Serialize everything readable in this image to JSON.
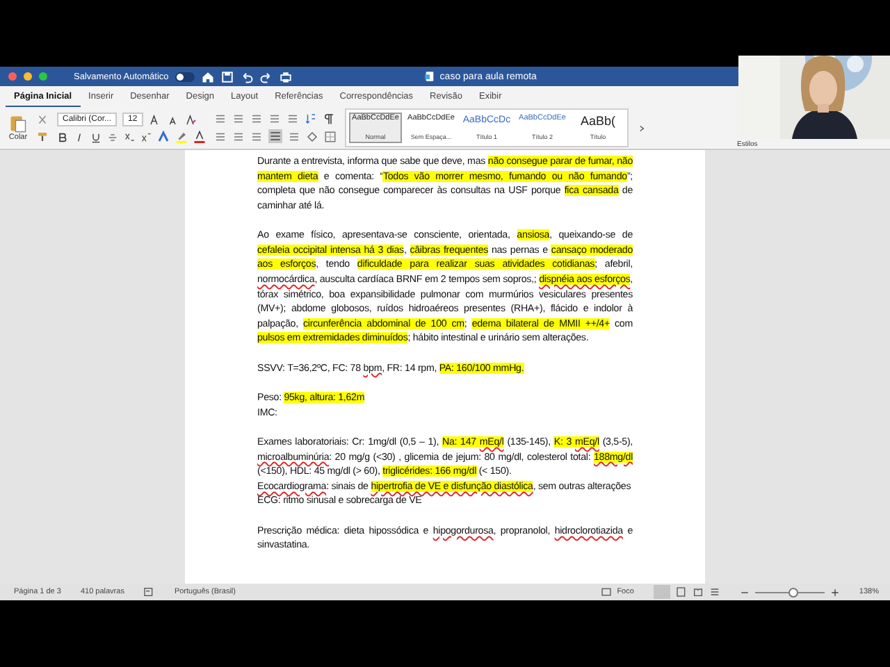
{
  "titlebar": {
    "autosave_label": "Salvamento Automático",
    "autosave_on": false,
    "title": "caso para aula remota"
  },
  "tabs": [
    {
      "label": "Página Inicial",
      "selected": true
    },
    {
      "label": "Inserir",
      "selected": false
    },
    {
      "label": "Desenhar",
      "selected": false
    },
    {
      "label": "Design",
      "selected": false
    },
    {
      "label": "Layout",
      "selected": false
    },
    {
      "label": "Referências",
      "selected": false
    },
    {
      "label": "Correspondências",
      "selected": false
    },
    {
      "label": "Revisão",
      "selected": false
    },
    {
      "label": "Exibir",
      "selected": false
    }
  ],
  "ribbon": {
    "paste_label": "Colar",
    "font": "Calibri (Cor...",
    "size": "12",
    "styles": [
      {
        "sample": "AaBbCcDdEe",
        "name": "Normal",
        "kind": "body",
        "selected": true
      },
      {
        "sample": "AaBbCcDdEe",
        "name": "Sem Espaça...",
        "kind": "body",
        "selected": false
      },
      {
        "sample": "AaBbCcDc",
        "name": "Título 1",
        "kind": "heading",
        "selected": false
      },
      {
        "sample": "AaBbCcDdEe",
        "name": "Título 2",
        "kind": "heading2",
        "selected": false
      },
      {
        "sample": "AaBb(",
        "name": "Título",
        "kind": "title",
        "selected": false
      }
    ],
    "styles_label": "Estilos"
  },
  "document": {
    "groups": [
      [
        [
          {
            "text": "Durante a entrevista, informa que sabe que deve, mas ",
            "kind": "plain"
          },
          {
            "text": "não consegue parar de fumar, não mantem dieta",
            "kind": "highlight"
          },
          {
            "text": " e comenta: “",
            "kind": "plain"
          },
          {
            "text": "Todos vão morrer mesmo, fumando ou não fumando",
            "kind": "highlight"
          },
          {
            "text": "”; completa que não consegue comparecer às consultas na USF porque ",
            "kind": "plain"
          },
          {
            "text": "fica cansada",
            "kind": "highlight"
          },
          {
            "text": " de caminhar até lá.",
            "kind": "plain"
          }
        ]
      ],
      [
        [
          {
            "text": "Ao exame físico, apresentava-se consciente, orientada, ",
            "kind": "plain"
          },
          {
            "text": "ansiosa",
            "kind": "highlight"
          },
          {
            "text": ", queixando-se de ",
            "kind": "plain"
          },
          {
            "text": "cefaleia occipital intensa há 3 dias",
            "kind": "highlight"
          },
          {
            "text": ", ",
            "kind": "plain"
          },
          {
            "text": "câibras frequentes",
            "kind": "highlight"
          },
          {
            "text": " nas pernas e ",
            "kind": "plain"
          },
          {
            "text": "cansaço moderado aos esforços",
            "kind": "highlight"
          },
          {
            "text": ", tendo ",
            "kind": "plain"
          },
          {
            "text": "dificuldade para realizar suas atividades cotidianas",
            "kind": "highlight"
          },
          {
            "text": "; afebril, ",
            "kind": "plain"
          },
          {
            "text": "normocárdica",
            "kind": "misspelled"
          },
          {
            "text": ", ausculta cardíaca BRNF em 2 tempos sem sopros,; ",
            "kind": "plain"
          },
          {
            "text": "dispnéia aos esforços",
            "kind": "highlight-misspelled"
          },
          {
            "text": ", tórax simétrico, boa expansibilidade pulmonar com murmúrios vesiculares presentes (MV+); abdome globosos, ruídos hidroaéreos presentes (RHA+), flácido e indolor à palpação, ",
            "kind": "plain"
          },
          {
            "text": "circunferência abdominal de 100 cm",
            "kind": "highlight"
          },
          {
            "text": "; ",
            "kind": "plain"
          },
          {
            "text": "edema bilateral de MMII ++/4+",
            "kind": "highlight"
          },
          {
            "text": " com ",
            "kind": "plain"
          },
          {
            "text": "pulsos em extremidades diminuídos",
            "kind": "highlight"
          },
          {
            "text": "; hábito intestinal e urinário sem alterações.",
            "kind": "plain"
          }
        ]
      ],
      [
        [
          {
            "text": "SSVV: T=36,2ºC, FC: 78 ",
            "kind": "plain"
          },
          {
            "text": "bpm",
            "kind": "misspelled"
          },
          {
            "text": ", FR: 14 rpm, ",
            "kind": "plain"
          },
          {
            "text": "PA: 160/100 mmHg.",
            "kind": "highlight"
          }
        ]
      ],
      [
        [
          {
            "text": "Peso: ",
            "kind": "plain"
          },
          {
            "text": "95kg, altura: 1,62m",
            "kind": "highlight"
          }
        ],
        [
          {
            "text": "IMC:",
            "kind": "plain"
          }
        ]
      ],
      [
        [
          {
            "text": "Exames laboratoriais: Cr: 1mg/dl (0,5 – 1), ",
            "kind": "plain"
          },
          {
            "text": "Na: 147 ",
            "kind": "highlight"
          },
          {
            "text": "mEq/l",
            "kind": "highlight-misspelled"
          },
          {
            "text": " (135-145), ",
            "kind": "plain"
          },
          {
            "text": "K: 3 ",
            "kind": "highlight"
          },
          {
            "text": "mEq/l",
            "kind": "highlight-misspelled"
          },
          {
            "text": " (3,5-5), ",
            "kind": "plain"
          },
          {
            "text": "microalbuminúria",
            "kind": "misspelled"
          },
          {
            "text": ": 20 mg/g (<30) , glicemia de jejum: 80 mg/dl, colesterol total: ",
            "kind": "plain"
          },
          {
            "text": "188mg/dl",
            "kind": "highlight-misspelled"
          },
          {
            "text": " (<150), HDL: 45 mg/dl (> 60), ",
            "kind": "plain"
          },
          {
            "text": "triglicérides: 166 mg/dl",
            "kind": "highlight"
          },
          {
            "text": " (< 150).",
            "kind": "plain"
          }
        ],
        [
          {
            "text": "Ecocardiograma",
            "kind": "misspelled"
          },
          {
            "text": ": sinais de ",
            "kind": "plain"
          },
          {
            "text": "hipertrofia de VE e disfunção diastólica",
            "kind": "highlight-misspelled"
          },
          {
            "text": ", sem outras alterações",
            "kind": "plain"
          }
        ],
        [
          {
            "text": "ECG: ritmo sinusal e sobrecarga de VE",
            "kind": "plain"
          }
        ]
      ],
      [
        [
          {
            "text": "Prescrição médica: dieta hipossódica e ",
            "kind": "plain"
          },
          {
            "text": "hipogordurosa",
            "kind": "misspelled"
          },
          {
            "text": ", propranolol, ",
            "kind": "plain"
          },
          {
            "text": "hidroclorotiazida",
            "kind": "misspelled"
          },
          {
            "text": " e sinvastatina.",
            "kind": "plain"
          }
        ]
      ]
    ]
  },
  "status_bar": {
    "page": "Página 1 de 3",
    "words": "410 palavras",
    "language": "Português (Brasil)",
    "focus": "Foco",
    "zoom": "138%",
    "zoom_slider": {
      "level": 0.55
    }
  }
}
